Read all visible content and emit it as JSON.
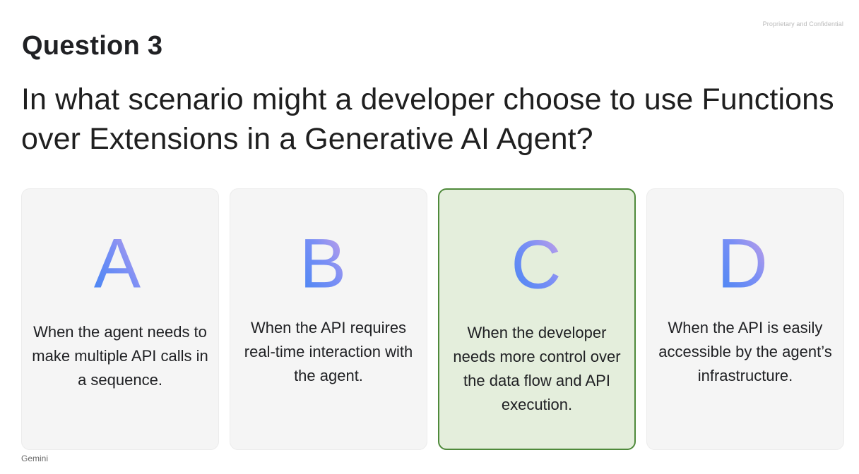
{
  "confidential": "Proprietary and Confidential",
  "question": {
    "label": "Question 3",
    "text": "In what scenario might a developer choose to use Functions over Extensions in a Generative AI Agent?"
  },
  "options": [
    {
      "letter": "A",
      "text": "When the agent needs to make multiple API calls in a sequence."
    },
    {
      "letter": "B",
      "text": "When the API requires real-time interaction with the agent."
    },
    {
      "letter": "C",
      "text": "When the developer needs more control over the data flow and API execution."
    },
    {
      "letter": "D",
      "text": "When the API is easily accessible by the agent’s infrastructure."
    }
  ],
  "selected_option": "C",
  "colors": {
    "letter_gradient_start": "#4285f4",
    "letter_gradient_mid": "#7b8ff5",
    "letter_gradient_end": "#d6a4e4",
    "selected_fill": "#e4eedc",
    "selected_border": "#4f8a3b",
    "card_fill": "#f5f5f5"
  },
  "footer": "Gemini"
}
